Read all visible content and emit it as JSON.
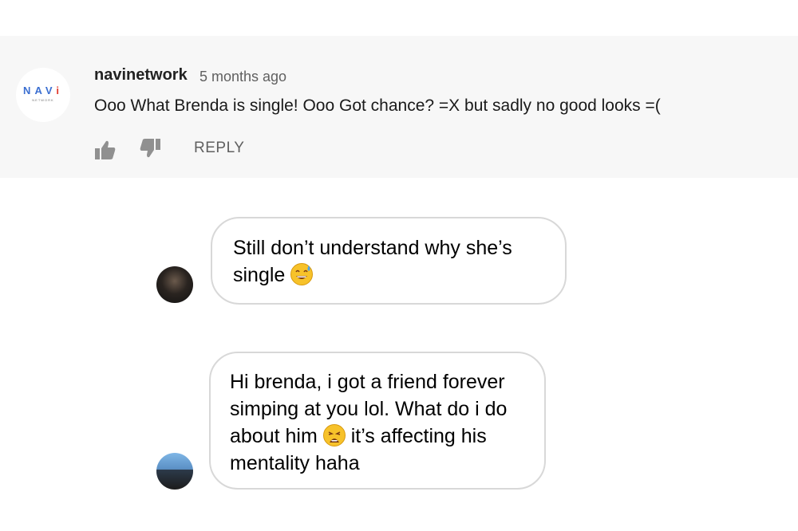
{
  "comment": {
    "avatar_text": "NAVI",
    "avatar_subtext": "NETWORK",
    "username": "navinetwork",
    "timestamp": "5 months ago",
    "text": "Ooo What Brenda is single! Ooo Got chance? =X but sadly no good looks =(",
    "reply_label": "REPLY",
    "icons": [
      "thumbs-up-icon",
      "thumbs-down-icon"
    ]
  },
  "chat": {
    "messages": [
      {
        "line1": "Still don’t understand why she’s",
        "line2_text": "single",
        "emoji": "grinning-sweat-emoji"
      },
      {
        "line1": "Hi brenda, i got a friend forever",
        "line2": "simping at you lol. What do i do",
        "line3_before": "about him",
        "line3_after": "it’s affecting his",
        "line4": "mentality haha",
        "emoji": "weary-face-emoji"
      }
    ]
  },
  "colors": {
    "panel_bg": "#f7f7f7",
    "meta_gray": "#606060",
    "bubble_border": "#d8d8d8",
    "navi_blue": "#3b6fd1",
    "navi_red": "#e23b2e",
    "navi_yellow": "#f2b400"
  }
}
